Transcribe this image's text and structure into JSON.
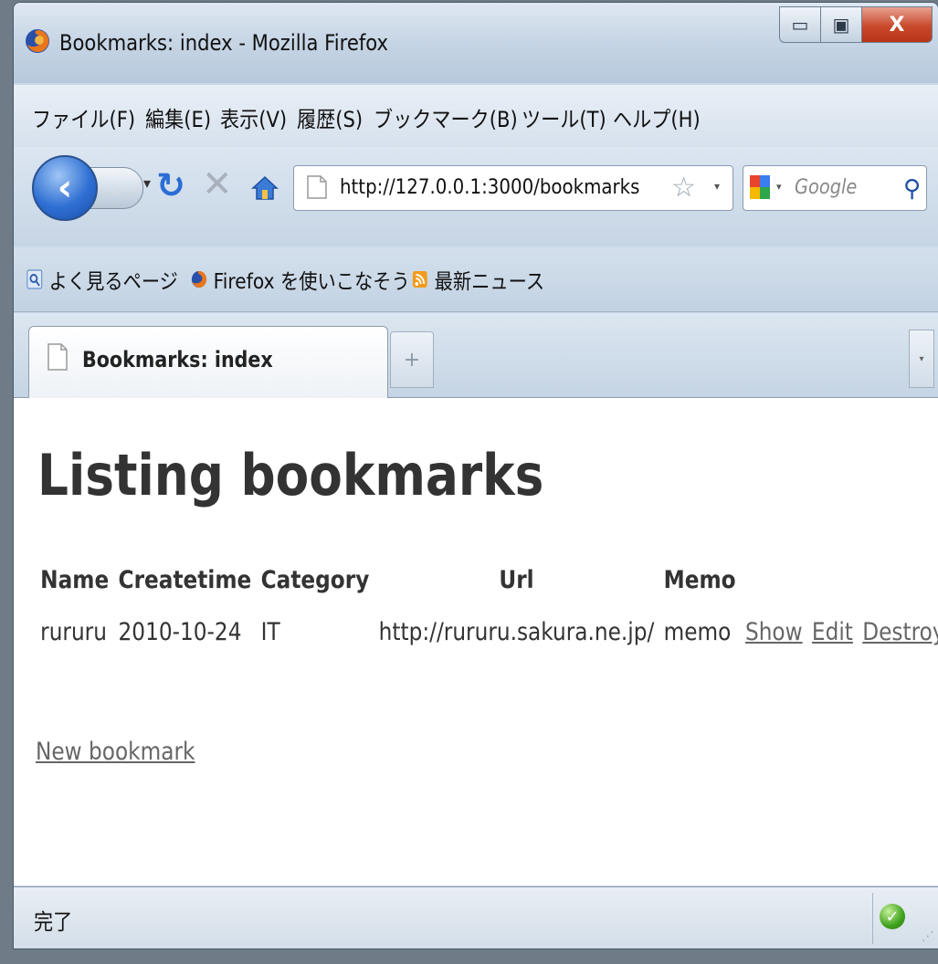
{
  "window": {
    "title": "Bookmarks: index - Mozilla Firefox",
    "minimize_label": "▭",
    "maximize_label": "▣",
    "close_label": "X"
  },
  "menubar": {
    "items": [
      {
        "label": "ファイル(F)"
      },
      {
        "label": "編集(E)"
      },
      {
        "label": "表示(V)"
      },
      {
        "label": "履歴(S)"
      },
      {
        "label": "ブックマーク(B)"
      },
      {
        "label": "ツール(T)"
      },
      {
        "label": "ヘルプ(H)"
      }
    ]
  },
  "navbar": {
    "url": "http://127.0.0.1:3000/bookmarks",
    "search_placeholder": "Google",
    "icons": [
      "back-icon",
      "forward-icon",
      "reload-icon",
      "stop-icon",
      "home-icon",
      "star-icon",
      "search-icon"
    ]
  },
  "bookmarks_toolbar": {
    "items": [
      {
        "label": "よく見るページ",
        "icon": "smart-bookmark-icon"
      },
      {
        "label": "Firefox を使いこなそう",
        "icon": "firefox-icon"
      },
      {
        "label": "最新ニュース",
        "icon": "rss-feed-icon"
      }
    ]
  },
  "tabs": {
    "active_label": "Bookmarks: index",
    "new_tab_label": "+",
    "list_label": "▾"
  },
  "page": {
    "heading": "Listing bookmarks",
    "columns": [
      "Name",
      "Createtime",
      "Category",
      "Url",
      "Memo"
    ],
    "rows": [
      {
        "name": "rururu",
        "createtime": "2010-10-24",
        "category": "IT",
        "url": "http://rururu.sakura.ne.jp/",
        "memo": "memo",
        "show": "Show",
        "edit": "Edit",
        "destroy": "Destroy"
      }
    ],
    "new_link": "New bookmark"
  },
  "statusbar": {
    "text": "完了"
  },
  "colors": {
    "chrome": "#c9d8e8",
    "accent_blue": "#2f6fd3",
    "close_red": "#c9492c",
    "text_dark": "#333333",
    "link_gray": "#666666"
  }
}
